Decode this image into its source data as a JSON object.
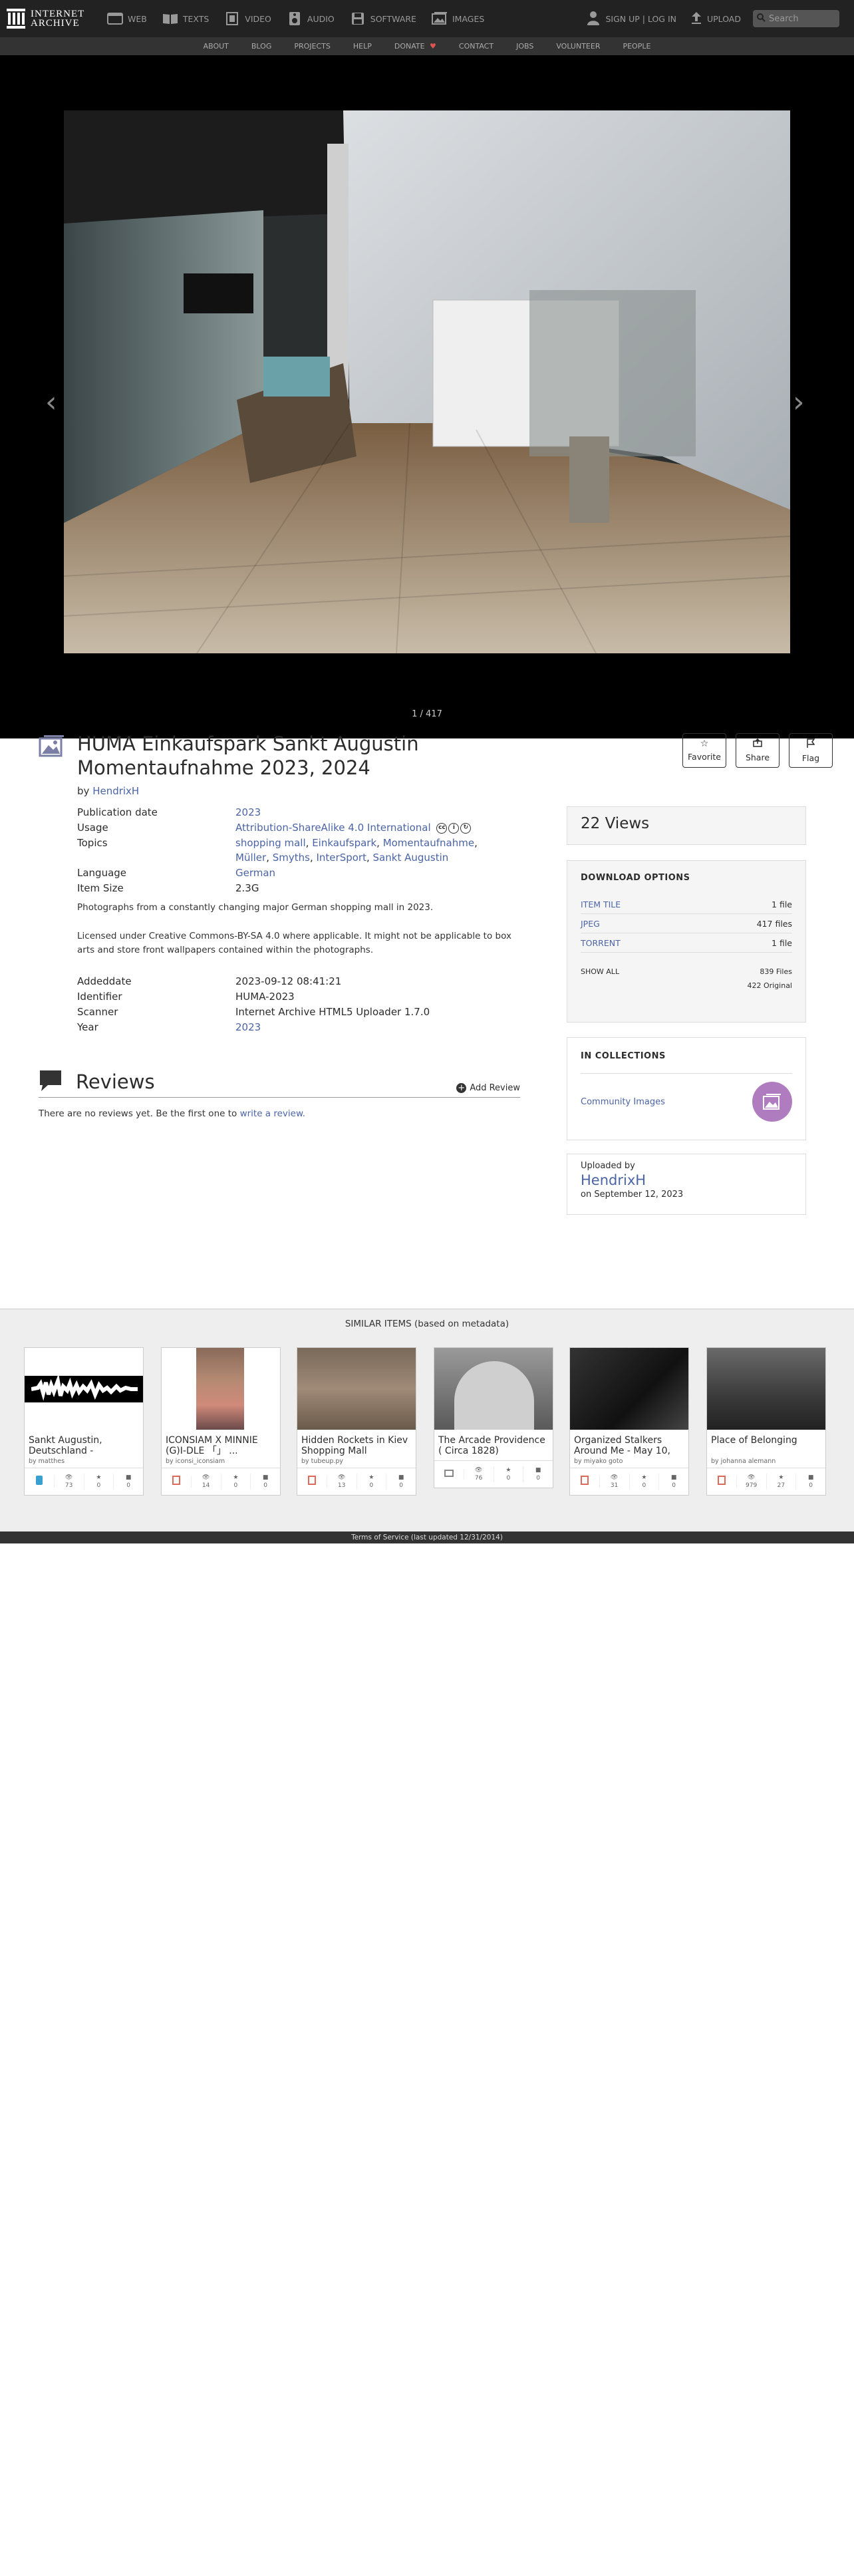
{
  "logo": {
    "line1": "INTERNET",
    "line2": "ARCHIVE"
  },
  "topnav": {
    "media": [
      {
        "label": "WEB",
        "icon": "web-icon"
      },
      {
        "label": "TEXTS",
        "icon": "book-icon"
      },
      {
        "label": "VIDEO",
        "icon": "film-icon"
      },
      {
        "label": "AUDIO",
        "icon": "speaker-icon"
      },
      {
        "label": "SOFTWARE",
        "icon": "floppy-icon"
      },
      {
        "label": "IMAGES",
        "icon": "image-icon"
      }
    ],
    "signin": "SIGN UP | LOG IN",
    "upload": "UPLOAD",
    "search_placeholder": "Search"
  },
  "subnav": [
    "ABOUT",
    "BLOG",
    "PROJECTS",
    "HELP",
    "DONATE",
    "CONTACT",
    "JOBS",
    "VOLUNTEER",
    "PEOPLE"
  ],
  "viewer": {
    "page_count": "1 / 417",
    "prev": "‹",
    "next": "›"
  },
  "item": {
    "title": "HUMA Einkaufspark Sankt Augustin Momentaufnahme 2023, 2024",
    "by_label": "by",
    "creator": "HendrixH",
    "actions": {
      "favorite": "Favorite",
      "share": "Share",
      "flag": "Flag"
    },
    "metadata": {
      "publication_date": {
        "label": "Publication date",
        "value": "2023"
      },
      "usage": {
        "label": "Usage",
        "value": "Attribution-ShareAlike 4.0 International"
      },
      "topics": {
        "label": "Topics",
        "values": [
          "shopping mall",
          "Einkaufspark",
          "Momentaufnahme",
          "Müller",
          "Smyths",
          "InterSport",
          "Sankt Augustin"
        ]
      },
      "language": {
        "label": "Language",
        "value": "German"
      },
      "item_size": {
        "label": "Item Size",
        "value": "2.3G"
      }
    },
    "description": [
      "Photographs from a constantly changing major German shopping mall in 2023.",
      "Licensed under Creative Commons-BY-SA 4.0 where applicable. It might not be applicable to box arts and store front wallpapers contained within the photographs."
    ],
    "metadata2": {
      "addeddate": {
        "label": "Addeddate",
        "value": "2023-09-12 08:41:21"
      },
      "identifier": {
        "label": "Identifier",
        "value": "HUMA-2023"
      },
      "scanner": {
        "label": "Scanner",
        "value": "Internet Archive HTML5 Uploader 1.7.0"
      },
      "year": {
        "label": "Year",
        "value": "2023"
      }
    }
  },
  "reviews": {
    "title": "Reviews",
    "add": "Add Review",
    "empty_text": "There are no reviews yet. Be the first one to",
    "empty_link": "write a review."
  },
  "sidebar": {
    "views": "22 Views",
    "download": {
      "title": "DOWNLOAD OPTIONS",
      "rows": [
        {
          "name": "ITEM TILE",
          "count": "1 file"
        },
        {
          "name": "JPEG",
          "count": "417 files"
        },
        {
          "name": "TORRENT",
          "count": "1 file"
        }
      ],
      "show_all": "SHOW ALL",
      "files": "839 Files",
      "original": "422 Original"
    },
    "collections": {
      "title": "IN COLLECTIONS",
      "items": [
        "Community Images"
      ]
    },
    "uploaded": {
      "label": "Uploaded by",
      "name": "HendrixH",
      "date": "on September 12, 2023"
    }
  },
  "similar": {
    "label": "SIMILAR ITEMS (based on metadata)",
    "items": [
      {
        "title": "Sankt Augustin, Deutschland -",
        "by": "by matthes",
        "type": "audio-icon",
        "views": "73",
        "favs": "0",
        "reviews": "0"
      },
      {
        "title": "ICONSIAM X MINNIE (G)I-DLE 「」 ...",
        "by": "by iconsi_iconsiam",
        "type": "movies-icon",
        "views": "14",
        "favs": "0",
        "reviews": "0"
      },
      {
        "title": "Hidden Rockets in Kiev Shopping Mall",
        "by": "by tubeup.py",
        "type": "movies-icon",
        "views": "13",
        "favs": "0",
        "reviews": "0"
      },
      {
        "title": "The Arcade Providence ( Circa 1828)",
        "by": "",
        "type": "image-icon",
        "views": "76",
        "favs": "0",
        "reviews": "0"
      },
      {
        "title": "Organized Stalkers Around Me - May 10,",
        "by": "by miyako goto",
        "type": "movies-icon",
        "views": "31",
        "favs": "0",
        "reviews": "0"
      },
      {
        "title": "Place of Belonging",
        "by": "by johanna alemann",
        "type": "movies-icon",
        "views": "979",
        "favs": "27",
        "reviews": "0"
      }
    ]
  },
  "footer": "Terms of Service (last updated 12/31/2014)",
  "colors": {
    "link": "#4b64a6",
    "topnav": "#222222",
    "subnav": "#333333",
    "collection_circle": "#b07cc0"
  }
}
